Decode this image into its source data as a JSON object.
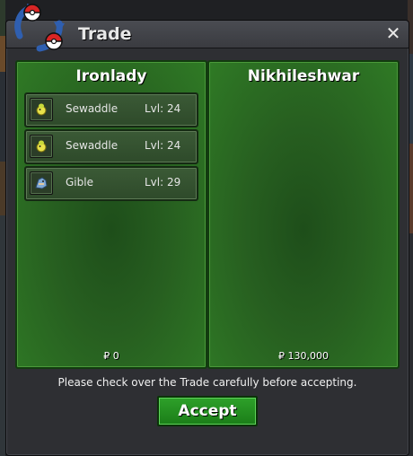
{
  "window": {
    "title": "Trade",
    "close_label": "✕"
  },
  "left_panel": {
    "player_name": "Ironlady",
    "money": "₽ 0",
    "slots": [
      {
        "name": "Sewaddle",
        "level": "Lvl: 24",
        "icon": "sewaddle-icon"
      },
      {
        "name": "Sewaddle",
        "level": "Lvl: 24",
        "icon": "sewaddle-icon"
      },
      {
        "name": "Gible",
        "level": "Lvl: 29",
        "icon": "gible-icon"
      }
    ]
  },
  "right_panel": {
    "player_name": "Nikhileshwar",
    "money": "₽ 130,000",
    "slots": []
  },
  "notice": "Please check over the Trade carefully before accepting.",
  "accept_label": "Accept",
  "colors": {
    "panel_green": "#2f7a25",
    "accept_green": "#2ea12a",
    "window_bg": "#2e2f33"
  }
}
